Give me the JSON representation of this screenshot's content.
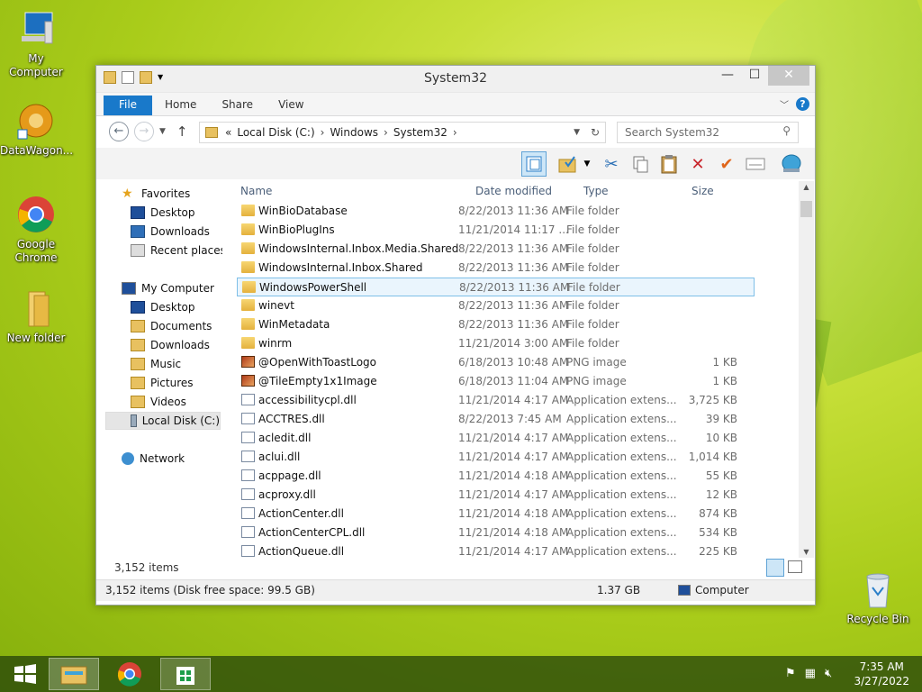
{
  "desktop": {
    "icons": [
      {
        "label": "My Computer"
      },
      {
        "label": "DataWagon..."
      },
      {
        "label": "Google Chrome"
      },
      {
        "label": "New folder"
      },
      {
        "label": "Recycle Bin"
      }
    ]
  },
  "window": {
    "title": "System32",
    "ribbon_tabs": [
      "File",
      "Home",
      "Share",
      "View"
    ],
    "address": {
      "prefix": "«",
      "segments": [
        "Local Disk (C:)",
        "Windows",
        "System32"
      ]
    },
    "search_placeholder": "Search System32"
  },
  "nav": {
    "favorites": "Favorites",
    "favorites_items": [
      "Desktop",
      "Downloads",
      "Recent places"
    ],
    "computer": "My Computer",
    "computer_items": [
      "Desktop",
      "Documents",
      "Downloads",
      "Music",
      "Pictures",
      "Videos",
      "Local Disk (C:)"
    ],
    "network": "Network"
  },
  "columns": [
    "Name",
    "Date modified",
    "Type",
    "Size"
  ],
  "files": [
    {
      "name": "WinBioDatabase",
      "date": "8/22/2013 11:36 AM",
      "type": "File folder",
      "size": "",
      "kind": "folder"
    },
    {
      "name": "WinBioPlugIns",
      "date": "11/21/2014 11:17 ...",
      "type": "File folder",
      "size": "",
      "kind": "folder"
    },
    {
      "name": "WindowsInternal.Inbox.Media.Shared",
      "date": "8/22/2013 11:36 AM",
      "type": "File folder",
      "size": "",
      "kind": "folder"
    },
    {
      "name": "WindowsInternal.Inbox.Shared",
      "date": "8/22/2013 11:36 AM",
      "type": "File folder",
      "size": "",
      "kind": "folder"
    },
    {
      "name": "WindowsPowerShell",
      "date": "8/22/2013 11:36 AM",
      "type": "File folder",
      "size": "",
      "kind": "folder"
    },
    {
      "name": "winevt",
      "date": "8/22/2013 11:36 AM",
      "type": "File folder",
      "size": "",
      "kind": "folder"
    },
    {
      "name": "WinMetadata",
      "date": "8/22/2013 11:36 AM",
      "type": "File folder",
      "size": "",
      "kind": "folder"
    },
    {
      "name": "winrm",
      "date": "11/21/2014 3:00 AM",
      "type": "File folder",
      "size": "",
      "kind": "folder"
    },
    {
      "name": "@OpenWithToastLogo",
      "date": "6/18/2013 10:48 AM",
      "type": "PNG image",
      "size": "1 KB",
      "kind": "png"
    },
    {
      "name": "@TileEmpty1x1Image",
      "date": "6/18/2013 11:04 AM",
      "type": "PNG image",
      "size": "1 KB",
      "kind": "png"
    },
    {
      "name": "accessibilitycpl.dll",
      "date": "11/21/2014 4:17 AM",
      "type": "Application extens...",
      "size": "3,725 KB",
      "kind": "dll"
    },
    {
      "name": "ACCTRES.dll",
      "date": "8/22/2013 7:45 AM",
      "type": "Application extens...",
      "size": "39 KB",
      "kind": "dll"
    },
    {
      "name": "acledit.dll",
      "date": "11/21/2014 4:17 AM",
      "type": "Application extens...",
      "size": "10 KB",
      "kind": "dll"
    },
    {
      "name": "aclui.dll",
      "date": "11/21/2014 4:17 AM",
      "type": "Application extens...",
      "size": "1,014 KB",
      "kind": "dll"
    },
    {
      "name": "acppage.dll",
      "date": "11/21/2014 4:18 AM",
      "type": "Application extens...",
      "size": "55 KB",
      "kind": "dll"
    },
    {
      "name": "acproxy.dll",
      "date": "11/21/2014 4:17 AM",
      "type": "Application extens...",
      "size": "12 KB",
      "kind": "dll"
    },
    {
      "name": "ActionCenter.dll",
      "date": "11/21/2014 4:18 AM",
      "type": "Application extens...",
      "size": "874 KB",
      "kind": "dll"
    },
    {
      "name": "ActionCenterCPL.dll",
      "date": "11/21/2014 4:18 AM",
      "type": "Application extens...",
      "size": "534 KB",
      "kind": "dll"
    },
    {
      "name": "ActionQueue.dll",
      "date": "11/21/2014 4:17 AM",
      "type": "Application extens...",
      "size": "225 KB",
      "kind": "dll"
    }
  ],
  "selected_row": 4,
  "status": {
    "item_count": "3,152 items",
    "details": "3,152 items (Disk free space: 99.5 GB)",
    "size": "1.37 GB",
    "location": "Computer"
  },
  "tray": {
    "time": "7:35 AM",
    "date": "3/27/2022"
  }
}
